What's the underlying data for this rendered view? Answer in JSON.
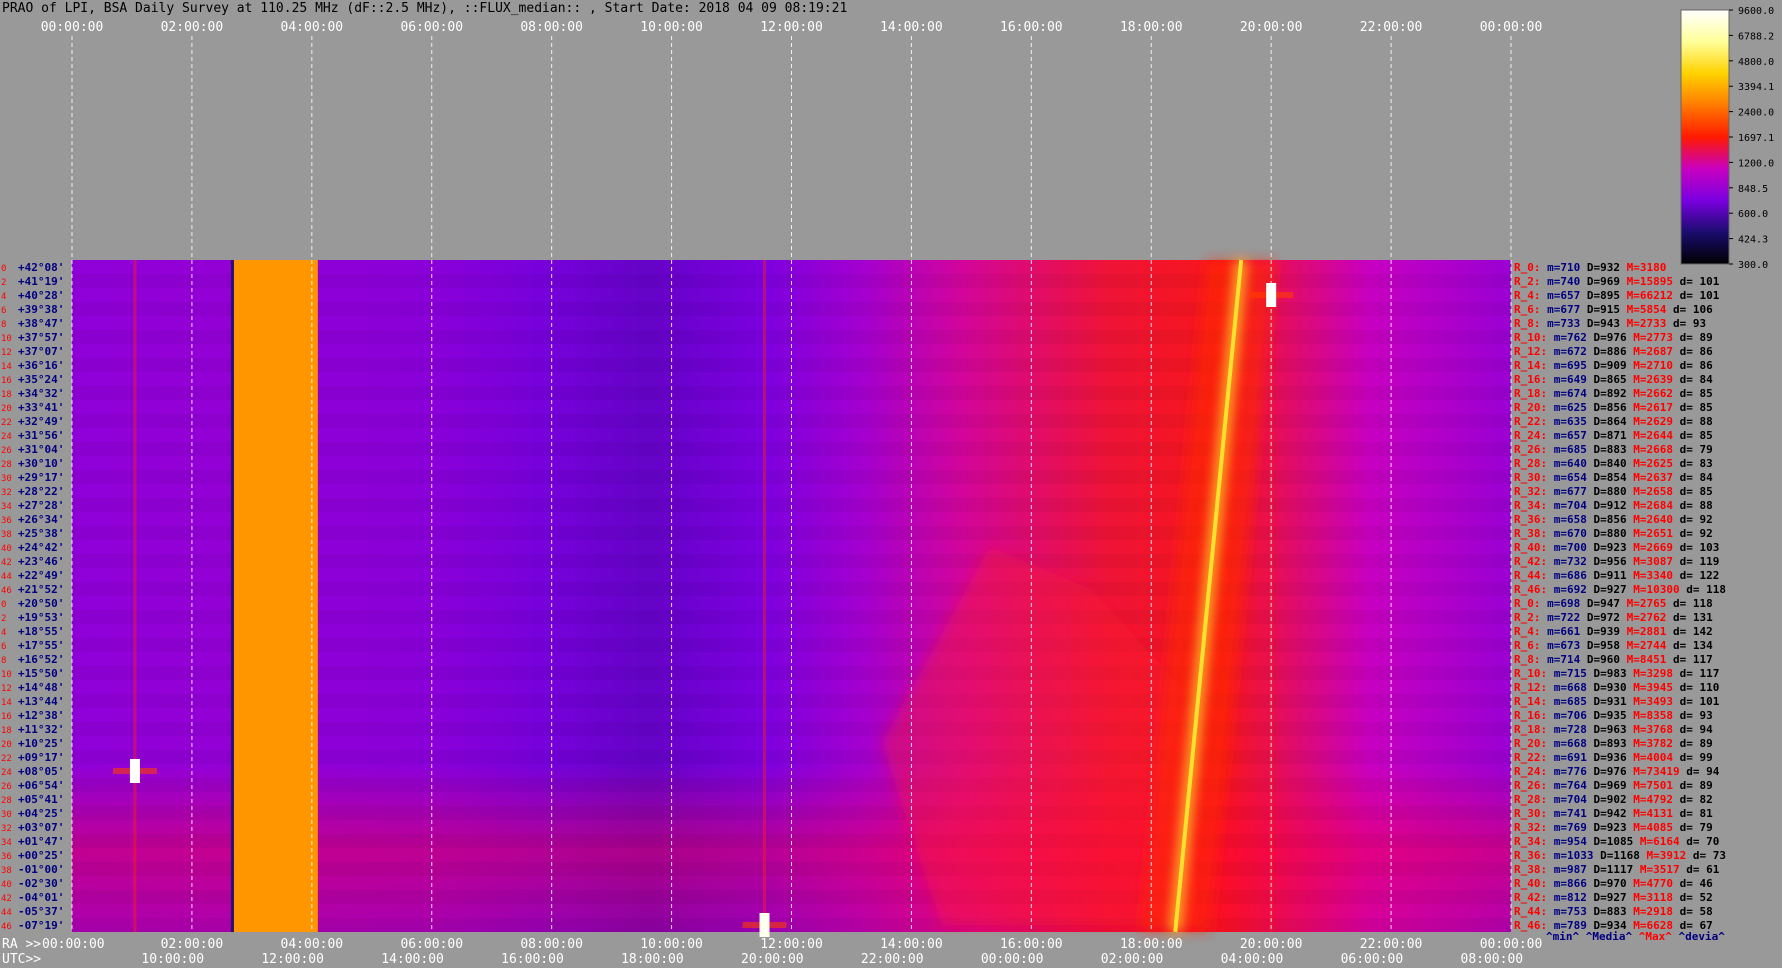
{
  "title": "PRAO of LPI, BSA Daily Survey at 110.25 MHz (dF::2.5 MHz), ::FLUX_median:: , Start Date: 2018 04 09 08:19:21",
  "chart_data": {
    "type": "heatmap",
    "title": "PRAO of LPI, BSA Daily Survey at 110.25 MHz (dF::2.5 MHz), ::FLUX_median:: , Start Date: 2018 04 09 08:19:21",
    "x_top_ticks": [
      "00:00:00",
      "02:00:00",
      "04:00:00",
      "06:00:00",
      "08:00:00",
      "10:00:00",
      "12:00:00",
      "14:00:00",
      "16:00:00",
      "18:00:00",
      "20:00:00",
      "22:00:00",
      "00:00:00"
    ],
    "ra_label": "RA >>",
    "ra_ticks": [
      "00:00:00",
      "02:00:00",
      "04:00:00",
      "06:00:00",
      "08:00:00",
      "10:00:00",
      "12:00:00",
      "14:00:00",
      "16:00:00",
      "18:00:00",
      "20:00:00",
      "22:00:00",
      "00:00:00"
    ],
    "utc_label": "UTC>>",
    "utc_ticks": [
      "10:00:00",
      "12:00:00",
      "14:00:00",
      "16:00:00",
      "18:00:00",
      "20:00:00",
      "22:00:00",
      "00:00:00",
      "02:00:00",
      "04:00:00",
      "06:00:00",
      "08:00:00"
    ],
    "row_indices": [
      "0",
      "2",
      "4",
      "6",
      "8",
      "10",
      "12",
      "14",
      "16",
      "18",
      "20",
      "22",
      "24",
      "26",
      "28",
      "30",
      "32",
      "34",
      "36",
      "38",
      "40",
      "42",
      "44",
      "46",
      "0",
      "2",
      "4",
      "6",
      "8",
      "10",
      "12",
      "14",
      "16",
      "18",
      "20",
      "22",
      "24",
      "26",
      "28",
      "30",
      "32",
      "34",
      "36",
      "38",
      "40",
      "42",
      "44",
      "46"
    ],
    "declinations": [
      "+42°08'",
      "+41°19'",
      "+40°28'",
      "+39°38'",
      "+38°47'",
      "+37°57'",
      "+37°07'",
      "+36°16'",
      "+35°24'",
      "+34°32'",
      "+33°41'",
      "+32°49'",
      "+31°56'",
      "+31°04'",
      "+30°10'",
      "+29°17'",
      "+28°22'",
      "+27°28'",
      "+26°34'",
      "+25°38'",
      "+24°42'",
      "+23°46'",
      "+22°49'",
      "+21°52'",
      "+20°50'",
      "+19°53'",
      "+18°55'",
      "+17°55'",
      "+16°52'",
      "+15°50'",
      "+14°48'",
      "+13°44'",
      "+12°38'",
      "+11°32'",
      "+10°25'",
      "+09°17'",
      "+08°05'",
      "+06°54'",
      "+05°41'",
      "+04°25'",
      "+03°07'",
      "+01°47'",
      "+00°25'",
      "-01°00'",
      "-02°30'",
      "-04°01'",
      "-05°37'",
      "-07°19'"
    ],
    "row_stats": [
      {
        "r": "R_0:",
        "min": "m=710",
        "med": "D=932",
        "max": "M=3180",
        "dev": ""
      },
      {
        "r": "R_2:",
        "min": "m=740",
        "med": "D=969",
        "max": "M=15895",
        "dev": "d= 101"
      },
      {
        "r": "R_4:",
        "min": "m=657",
        "med": "D=895",
        "max": "M=66212",
        "dev": "d= 101"
      },
      {
        "r": "R_6:",
        "min": "m=677",
        "med": "D=915",
        "max": "M=5854",
        "dev": "d= 106"
      },
      {
        "r": "R_8:",
        "min": "m=733",
        "med": "D=943",
        "max": "M=2733",
        "dev": "d= 93"
      },
      {
        "r": "R_10:",
        "min": "m=762",
        "med": "D=976",
        "max": "M=2773",
        "dev": "d= 89"
      },
      {
        "r": "R_12:",
        "min": "m=672",
        "med": "D=886",
        "max": "M=2687",
        "dev": "d= 86"
      },
      {
        "r": "R_14:",
        "min": "m=695",
        "med": "D=909",
        "max": "M=2710",
        "dev": "d= 86"
      },
      {
        "r": "R_16:",
        "min": "m=649",
        "med": "D=865",
        "max": "M=2639",
        "dev": "d= 84"
      },
      {
        "r": "R_18:",
        "min": "m=674",
        "med": "D=892",
        "max": "M=2662",
        "dev": "d= 85"
      },
      {
        "r": "R_20:",
        "min": "m=625",
        "med": "D=856",
        "max": "M=2617",
        "dev": "d= 85"
      },
      {
        "r": "R_22:",
        "min": "m=635",
        "med": "D=864",
        "max": "M=2629",
        "dev": "d= 88"
      },
      {
        "r": "R_24:",
        "min": "m=657",
        "med": "D=871",
        "max": "M=2644",
        "dev": "d= 85"
      },
      {
        "r": "R_26:",
        "min": "m=685",
        "med": "D=883",
        "max": "M=2668",
        "dev": "d= 79"
      },
      {
        "r": "R_28:",
        "min": "m=640",
        "med": "D=840",
        "max": "M=2625",
        "dev": "d= 83"
      },
      {
        "r": "R_30:",
        "min": "m=654",
        "med": "D=854",
        "max": "M=2637",
        "dev": "d= 84"
      },
      {
        "r": "R_32:",
        "min": "m=677",
        "med": "D=880",
        "max": "M=2658",
        "dev": "d= 85"
      },
      {
        "r": "R_34:",
        "min": "m=704",
        "med": "D=912",
        "max": "M=2684",
        "dev": "d= 88"
      },
      {
        "r": "R_36:",
        "min": "m=658",
        "med": "D=856",
        "max": "M=2640",
        "dev": "d= 92"
      },
      {
        "r": "R_38:",
        "min": "m=670",
        "med": "D=880",
        "max": "M=2651",
        "dev": "d= 92"
      },
      {
        "r": "R_40:",
        "min": "m=700",
        "med": "D=923",
        "max": "M=2669",
        "dev": "d= 103"
      },
      {
        "r": "R_42:",
        "min": "m=732",
        "med": "D=956",
        "max": "M=3087",
        "dev": "d= 119"
      },
      {
        "r": "R_44:",
        "min": "m=686",
        "med": "D=911",
        "max": "M=3340",
        "dev": "d= 122"
      },
      {
        "r": "R_46:",
        "min": "m=692",
        "med": "D=927",
        "max": "M=10300",
        "dev": "d= 118"
      },
      {
        "r": "R_0:",
        "min": "m=698",
        "med": "D=947",
        "max": "M=2765",
        "dev": "d= 118"
      },
      {
        "r": "R_2:",
        "min": "m=722",
        "med": "D=972",
        "max": "M=2762",
        "dev": "d= 131"
      },
      {
        "r": "R_4:",
        "min": "m=661",
        "med": "D=939",
        "max": "M=2881",
        "dev": "d= 142"
      },
      {
        "r": "R_6:",
        "min": "m=673",
        "med": "D=958",
        "max": "M=2744",
        "dev": "d= 134"
      },
      {
        "r": "R_8:",
        "min": "m=714",
        "med": "D=960",
        "max": "M=8451",
        "dev": "d= 117"
      },
      {
        "r": "R_10:",
        "min": "m=715",
        "med": "D=983",
        "max": "M=3298",
        "dev": "d= 117"
      },
      {
        "r": "R_12:",
        "min": "m=668",
        "med": "D=930",
        "max": "M=3945",
        "dev": "d= 110"
      },
      {
        "r": "R_14:",
        "min": "m=685",
        "med": "D=931",
        "max": "M=3493",
        "dev": "d= 101"
      },
      {
        "r": "R_16:",
        "min": "m=706",
        "med": "D=935",
        "max": "M=8358",
        "dev": "d= 93"
      },
      {
        "r": "R_18:",
        "min": "m=728",
        "med": "D=963",
        "max": "M=3768",
        "dev": "d= 94"
      },
      {
        "r": "R_20:",
        "min": "m=668",
        "med": "D=893",
        "max": "M=3782",
        "dev": "d= 89"
      },
      {
        "r": "R_22:",
        "min": "m=691",
        "med": "D=936",
        "max": "M=4004",
        "dev": "d= 99"
      },
      {
        "r": "R_24:",
        "min": "m=776",
        "med": "D=976",
        "max": "M=73419",
        "dev": "d= 94"
      },
      {
        "r": "R_26:",
        "min": "m=764",
        "med": "D=969",
        "max": "M=7501",
        "dev": "d= 89"
      },
      {
        "r": "R_28:",
        "min": "m=704",
        "med": "D=902",
        "max": "M=4792",
        "dev": "d= 82"
      },
      {
        "r": "R_30:",
        "min": "m=741",
        "med": "D=942",
        "max": "M=4131",
        "dev": "d= 81"
      },
      {
        "r": "R_32:",
        "min": "m=769",
        "med": "D=923",
        "max": "M=4085",
        "dev": "d= 79"
      },
      {
        "r": "R_34:",
        "min": "m=954",
        "med": "D=1085",
        "max": "M=6164",
        "dev": "d= 70"
      },
      {
        "r": "R_36:",
        "min": "m=1033",
        "med": "D=1168",
        "max": "M=3912",
        "dev": "d= 73"
      },
      {
        "r": "R_38:",
        "min": "m=987",
        "med": "D=1117",
        "max": "M=3517",
        "dev": "d= 61"
      },
      {
        "r": "R_40:",
        "min": "m=866",
        "med": "D=970",
        "max": "M=4770",
        "dev": "d= 46"
      },
      {
        "r": "R_42:",
        "min": "m=812",
        "med": "D=927",
        "max": "M=3118",
        "dev": "d= 52"
      },
      {
        "r": "R_44:",
        "min": "m=753",
        "med": "D=883",
        "max": "M=2918",
        "dev": "d= 58"
      },
      {
        "r": "R_46:",
        "min": "m=789",
        "med": "D=934",
        "max": "M=6628",
        "dev": "d= 67"
      }
    ],
    "stats_legend": {
      "min": "^min^",
      "median": "^Media^",
      "max": "^Max^",
      "dev": "^devia^"
    },
    "colorbar_ticks": [
      "9600.0",
      "6788.2",
      "4800.0",
      "3394.1",
      "2400.0",
      "1697.1",
      "1200.0",
      "848.5",
      "600.0",
      "424.3",
      "300.0"
    ],
    "colorbar_range": [
      300,
      9600
    ],
    "colorbar_scale": "log",
    "colorscale": [
      "#000000",
      "#1a0c6e",
      "#7a00e0",
      "#c800c0",
      "#ff1a00",
      "#ff7a00",
      "#ffd200",
      "#ffff9a",
      "#ffffff"
    ],
    "x_range_hours": [
      0,
      24
    ],
    "grid": "dashed vertical, every 2 hours",
    "features": [
      {
        "name": "calibration band",
        "ra_start": 2.7,
        "ra_end": 4.1,
        "value": 3000
      },
      {
        "name": "diagonal ridge",
        "ra_start": 19.5,
        "ra_end": 18.4,
        "peak": 4600
      },
      {
        "name": "point source",
        "ra": 1.05,
        "row": 36,
        "value": 9600
      },
      {
        "name": "point source",
        "ra": 20.0,
        "row": 2,
        "value": 9600
      },
      {
        "name": "point source",
        "ra": 11.55,
        "row": 47,
        "value": 9000
      }
    ]
  },
  "colors": {
    "background": "#999999",
    "min_text": "#000080",
    "median_text": "#000000",
    "max_text": "#ff0000",
    "row_label": "#000080",
    "index": "#ff0000"
  }
}
